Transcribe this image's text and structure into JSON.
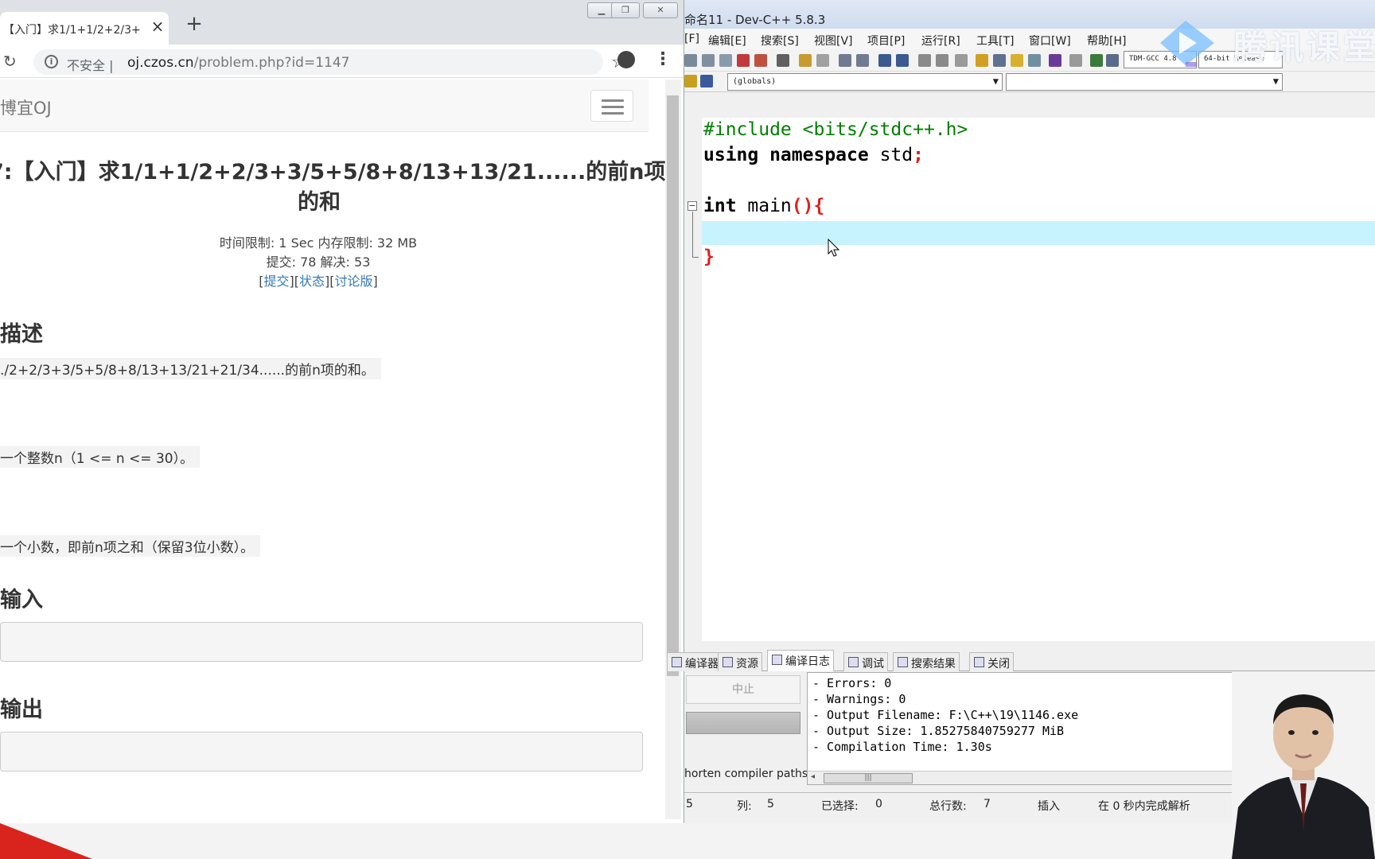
{
  "browser": {
    "tab_title": "【入门】求1/1+1/2+2/3+",
    "insecure_label": "不安全 |",
    "url_host": "oj.czos.cn",
    "url_rest": "/problem.php?id=1147",
    "brand": "博宜OJ",
    "problem": {
      "title_line1": "7:【入门】求1/1+1/2+2/3+3/5+5/8+8/13+13/21......的前n项",
      "title_line2": "的和",
      "limits": "时间限制: 1 Sec  内存限制: 32 MB",
      "stats": "提交: 78  解决: 53",
      "link_submit": "提交",
      "link_status": "状态",
      "link_discuss": "讨论版",
      "heading_desc": "描述",
      "desc_text": "./2+2/3+3/5+5/8+8/13+13/21+21/34......的前n项的和。",
      "input_text": "一个整数n（1 <= n <= 30）。",
      "output_text": "一个小数，即前n项之和（保留3位小数）。",
      "heading_sample_input": "输入",
      "heading_sample_output": "输出"
    }
  },
  "devcpp": {
    "title": "命名11 - Dev-C++ 5.8.3",
    "menu": [
      "[F]",
      "编辑[E]",
      "搜索[S]",
      "视图[V]",
      "项目[P]",
      "运行[R]",
      "工具[T]",
      "窗口[W]",
      "帮助[H]"
    ],
    "toolbar_compiler": "TDM-GCC 4.8",
    "toolbar_build": "64-bit Release",
    "combo_scope": "(globals)",
    "code": {
      "line1": "#include <bits/stdc++.h>",
      "line2_kw": "using namespace",
      "line2_rest": " std",
      "line2_semi": ";",
      "line4_kw": "int",
      "line4_name": " main",
      "line4_paren": "(){",
      "line6": "}"
    },
    "bottom_tabs": [
      "编译器",
      "资源",
      "编译日志",
      "调试",
      "搜索结果",
      "关闭"
    ],
    "active_tab": "编译日志",
    "abort_button": "中止",
    "shorten_label": "horten compiler paths",
    "log": [
      "- Errors: 0",
      "- Warnings: 0",
      "- Output Filename: F:\\C++\\19\\1146.exe",
      "- Output Size: 1.85275840759277 MiB",
      "- Compilation Time: 1.30s"
    ],
    "status": {
      "line": "5",
      "col_label": "列:",
      "col": "5",
      "sel_label": "已选择:",
      "sel": "0",
      "total_label": "总行数:",
      "total": "7",
      "mode": "插入",
      "parse": "在 0 秒内完成解析"
    }
  },
  "watermark": "腾讯课堂"
}
